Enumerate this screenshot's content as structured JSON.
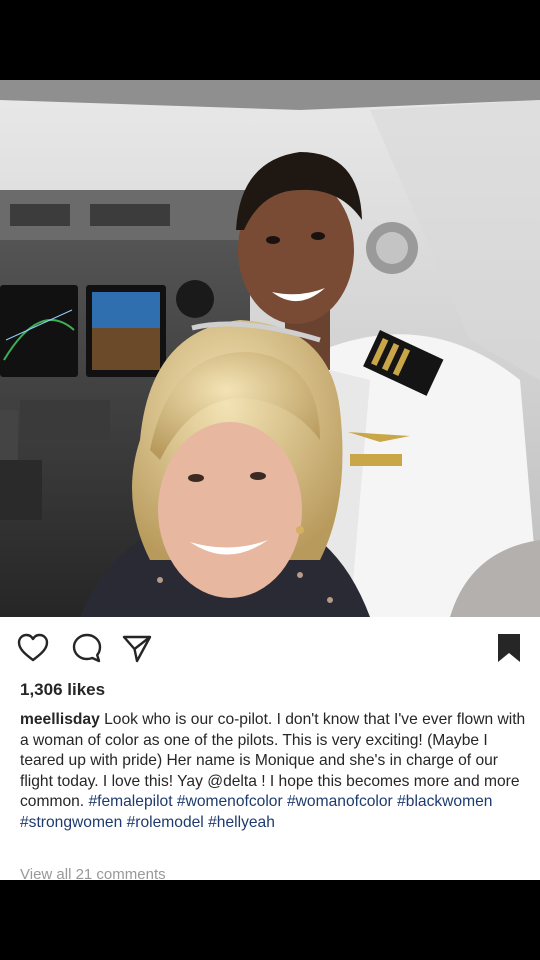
{
  "post": {
    "likes": "1,306 likes",
    "username": "meellisday",
    "caption_parts": {
      "p1": " Look who is our co-pilot. I don't know that I've ever flown with a woman of color as one of the pilots. This is very exciting! (Maybe I teared up with pride) Her name is Monique and she's in charge of our flight today. I love this! Yay ",
      "mention": "@delta",
      "p2": " ! I hope this becomes more and more common. "
    },
    "hashtags": [
      "#femalepilot",
      "#womenofcolor",
      "#womanofcolor",
      "#blackwomen",
      "#strongwomen",
      "#rolemodel",
      "#hellyeah"
    ],
    "view_comments": "View all 21 comments"
  },
  "icons": {
    "like": "heart-icon",
    "comment": "comment-bubble-icon",
    "share": "paper-plane-icon",
    "save": "bookmark-icon"
  },
  "colors": {
    "text": "#262626",
    "hashtag": "#1e3a6e",
    "muted": "#999999",
    "background": "#000000"
  }
}
